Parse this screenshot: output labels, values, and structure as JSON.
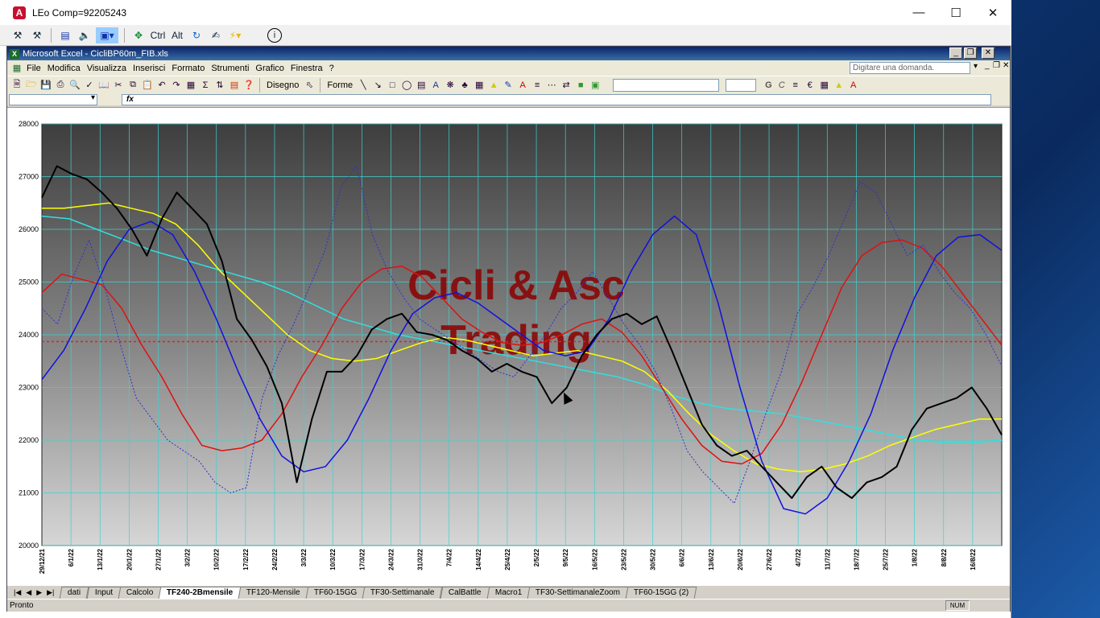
{
  "remote": {
    "title": "LEo Comp=92205243",
    "app_icon": "A",
    "toolbar": {
      "ctrl": "Ctrl",
      "alt": "Alt"
    }
  },
  "excel": {
    "title": "Microsoft Excel - CicliBP60m_FIB.xls",
    "menus": [
      "File",
      "Modifica",
      "Visualizza",
      "Inserisci",
      "Formato",
      "Strumenti",
      "Grafico",
      "Finestra",
      "?"
    ],
    "ask_placeholder": "Digitare una domanda.",
    "drawing": {
      "disegno": "Disegno",
      "forme": "Forme"
    },
    "format_buttons": {
      "bold": "G",
      "italic": "C"
    },
    "fx": "fx",
    "sheet_tabs": [
      "dati",
      "Input",
      "Calcolo",
      "TF240-2Bmensile",
      "TF120-Mensile",
      "TF60-15GG",
      "TF30-Settimanale",
      "CalBattle",
      "Macro1",
      "TF30-SettimanaleZoom",
      "TF60-15GG (2)"
    ],
    "active_tab": "TF240-2Bmensile",
    "status": "Pronto",
    "num_indicator": "NUM"
  },
  "chart_data": {
    "type": "line",
    "watermark": [
      "Cicli & Asc",
      "Trading"
    ],
    "y_ticks": [
      "28000",
      "27000",
      "26000",
      "25000",
      "24000",
      "23000",
      "22000",
      "21000",
      "20000"
    ],
    "ylim": [
      20000,
      28000
    ],
    "x_ticks": [
      "29/12/21",
      "6/1/22",
      "13/1/22",
      "20/1/22",
      "27/1/22",
      "3/2/22",
      "10/2/22",
      "17/2/22",
      "24/2/22",
      "3/3/22",
      "10/3/22",
      "17/3/22",
      "24/3/22",
      "31/3/22",
      "7/4/22",
      "14/4/22",
      "25/4/22",
      "2/5/22",
      "9/5/22",
      "16/5/22",
      "23/5/22",
      "30/5/22",
      "6/6/22",
      "13/6/22",
      "20/6/22",
      "27/6/22",
      "4/7/22",
      "11/7/22",
      "18/7/22",
      "25/7/22",
      "1/8/22",
      "8/8/22",
      "16/8/22"
    ],
    "horizontal_level": 23870,
    "colors": {
      "price": "#000000",
      "dotted": "#3030d0",
      "red": "#e01010",
      "yellow": "#ffff00",
      "cyan": "#30e0e0",
      "blue": "#1010e0",
      "level": "#e02020"
    },
    "series": [
      {
        "key": "price",
        "values": [
          26600,
          27200,
          27050,
          26950,
          26700,
          26400,
          26000,
          25500,
          26200,
          26700,
          26400,
          26100,
          25400,
          24300,
          23900,
          23400,
          22700,
          21200,
          22400,
          23300,
          23300,
          23600,
          24100,
          24300,
          24400,
          24050,
          24000,
          23900,
          23700,
          23550,
          23300,
          23450,
          23300,
          23200,
          22700,
          23000,
          23600,
          24000,
          24300,
          24400,
          24200,
          24350,
          23700,
          23000,
          22300,
          21900,
          21700,
          21800,
          21500,
          21200,
          20900,
          21300,
          21500,
          21100,
          20900,
          21200,
          21300,
          21500,
          22200,
          22600,
          22700,
          22800,
          23000,
          22600,
          22100
        ]
      },
      {
        "key": "dotted",
        "values": [
          24500,
          24200,
          25100,
          25800,
          24900,
          23800,
          22800,
          22400,
          22000,
          21800,
          21600,
          21200,
          21000,
          21100,
          22800,
          23600,
          24200,
          24900,
          25600,
          26800,
          27200,
          25900,
          25200,
          24700,
          24300,
          24100,
          23900,
          23700,
          23500,
          23300,
          23200,
          23600,
          24000,
          24500,
          24800,
          25200,
          24700,
          24200,
          23800,
          23300,
          22600,
          21800,
          21400,
          21100,
          20800,
          21600,
          22500,
          23300,
          24400,
          24900,
          25500,
          26200,
          26900,
          26700,
          26100,
          25500,
          25700,
          25200,
          24800,
          24500,
          24000,
          23400
        ]
      },
      {
        "key": "red",
        "values": [
          24800,
          25150,
          25050,
          24950,
          24500,
          23800,
          23200,
          22500,
          21900,
          21800,
          21850,
          22000,
          22500,
          23200,
          23800,
          24500,
          25000,
          25250,
          25300,
          25100,
          24700,
          24300,
          24050,
          23850,
          23800,
          23850,
          24000,
          24200,
          24300,
          24050,
          23600,
          23000,
          22400,
          21900,
          21600,
          21550,
          21750,
          22300,
          23100,
          24000,
          24900,
          25500,
          25750,
          25800,
          25650,
          25300,
          24800,
          24300,
          23800
        ]
      },
      {
        "key": "yellow",
        "values": [
          26400,
          26400,
          26450,
          26500,
          26400,
          26300,
          26100,
          25700,
          25200,
          24800,
          24400,
          24000,
          23700,
          23550,
          23500,
          23550,
          23700,
          23850,
          23950,
          23900,
          23800,
          23700,
          23600,
          23650,
          23700,
          23600,
          23500,
          23300,
          22950,
          22500,
          22100,
          21800,
          21550,
          21450,
          21400,
          21450,
          21550,
          21700,
          21900,
          22050,
          22200,
          22300,
          22400,
          22400
        ]
      },
      {
        "key": "cyan",
        "values": [
          26250,
          26200,
          26000,
          25800,
          25600,
          25450,
          25300,
          25150,
          25000,
          24800,
          24550,
          24300,
          24150,
          24000,
          23900,
          23800,
          23700,
          23600,
          23500,
          23400,
          23300,
          23200,
          23050,
          22850,
          22700,
          22600,
          22550,
          22500,
          22400,
          22300,
          22200,
          22100,
          22000,
          21950,
          21950,
          22000
        ]
      },
      {
        "key": "blue",
        "values": [
          23150,
          23700,
          24500,
          25400,
          26000,
          26150,
          25900,
          25200,
          24300,
          23300,
          22400,
          21700,
          21400,
          21500,
          22000,
          22800,
          23700,
          24400,
          24700,
          24800,
          24600,
          24300,
          24000,
          23700,
          23600,
          23700,
          24300,
          25200,
          25900,
          26250,
          25900,
          24600,
          23000,
          21600,
          20700,
          20600,
          20900,
          21600,
          22500,
          23700,
          24700,
          25500,
          25850,
          25900,
          25600
        ]
      }
    ]
  }
}
